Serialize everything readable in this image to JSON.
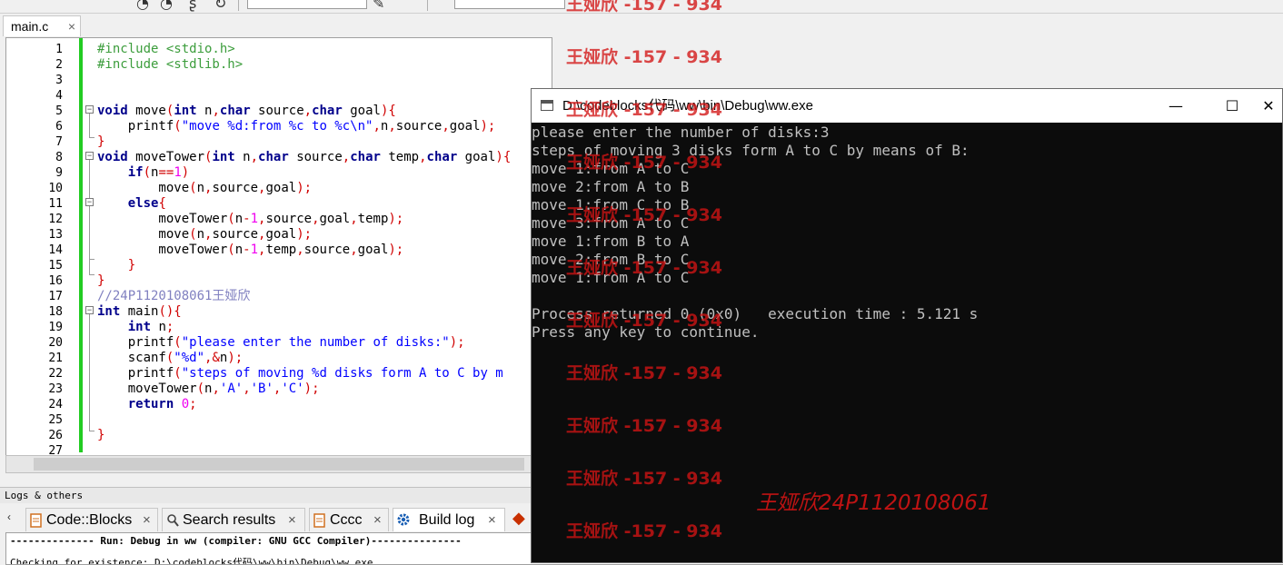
{
  "editor": {
    "tab_label": "main.c",
    "tab_close": "×",
    "line_numbers": [
      "1",
      "2",
      "3",
      "4",
      "5",
      "6",
      "7",
      "8",
      "9",
      "10",
      "11",
      "12",
      "13",
      "14",
      "15",
      "16",
      "17",
      "18",
      "19",
      "20",
      "21",
      "22",
      "23",
      "24",
      "25",
      "26",
      "27"
    ],
    "lines": [
      [
        {
          "t": "pp",
          "v": "#include <stdio.h>"
        }
      ],
      [
        {
          "t": "pp",
          "v": "#include <stdlib.h>"
        }
      ],
      [],
      [],
      [
        {
          "t": "kw",
          "v": "void"
        },
        {
          "t": "pl",
          "v": " move"
        },
        {
          "t": "op",
          "v": "("
        },
        {
          "t": "kw",
          "v": "int"
        },
        {
          "t": "pl",
          "v": " n"
        },
        {
          "t": "op",
          "v": ","
        },
        {
          "t": "kw",
          "v": "char"
        },
        {
          "t": "pl",
          "v": " source"
        },
        {
          "t": "op",
          "v": ","
        },
        {
          "t": "kw",
          "v": "char"
        },
        {
          "t": "pl",
          "v": " goal"
        },
        {
          "t": "op",
          "v": "){"
        }
      ],
      [
        {
          "t": "pl",
          "v": "    printf"
        },
        {
          "t": "op",
          "v": "("
        },
        {
          "t": "str",
          "v": "\"move %d:from %c to %c\\n\""
        },
        {
          "t": "op",
          "v": ","
        },
        {
          "t": "pl",
          "v": "n"
        },
        {
          "t": "op",
          "v": ","
        },
        {
          "t": "pl",
          "v": "source"
        },
        {
          "t": "op",
          "v": ","
        },
        {
          "t": "pl",
          "v": "goal"
        },
        {
          "t": "op",
          "v": ");"
        }
      ],
      [
        {
          "t": "op",
          "v": "}"
        }
      ],
      [
        {
          "t": "kw",
          "v": "void"
        },
        {
          "t": "pl",
          "v": " moveTower"
        },
        {
          "t": "op",
          "v": "("
        },
        {
          "t": "kw",
          "v": "int"
        },
        {
          "t": "pl",
          "v": " n"
        },
        {
          "t": "op",
          "v": ","
        },
        {
          "t": "kw",
          "v": "char"
        },
        {
          "t": "pl",
          "v": " source"
        },
        {
          "t": "op",
          "v": ","
        },
        {
          "t": "kw",
          "v": "char"
        },
        {
          "t": "pl",
          "v": " temp"
        },
        {
          "t": "op",
          "v": ","
        },
        {
          "t": "kw",
          "v": "char"
        },
        {
          "t": "pl",
          "v": " goal"
        },
        {
          "t": "op",
          "v": "){"
        }
      ],
      [
        {
          "t": "pl",
          "v": "    "
        },
        {
          "t": "kw",
          "v": "if"
        },
        {
          "t": "op",
          "v": "("
        },
        {
          "t": "pl",
          "v": "n"
        },
        {
          "t": "op",
          "v": "=="
        },
        {
          "t": "num",
          "v": "1"
        },
        {
          "t": "op",
          "v": ")"
        }
      ],
      [
        {
          "t": "pl",
          "v": "        move"
        },
        {
          "t": "op",
          "v": "("
        },
        {
          "t": "pl",
          "v": "n"
        },
        {
          "t": "op",
          "v": ","
        },
        {
          "t": "pl",
          "v": "source"
        },
        {
          "t": "op",
          "v": ","
        },
        {
          "t": "pl",
          "v": "goal"
        },
        {
          "t": "op",
          "v": ");"
        }
      ],
      [
        {
          "t": "pl",
          "v": "    "
        },
        {
          "t": "kw",
          "v": "else"
        },
        {
          "t": "op",
          "v": "{"
        }
      ],
      [
        {
          "t": "pl",
          "v": "        moveTower"
        },
        {
          "t": "op",
          "v": "("
        },
        {
          "t": "pl",
          "v": "n"
        },
        {
          "t": "op",
          "v": "-"
        },
        {
          "t": "num",
          "v": "1"
        },
        {
          "t": "op",
          "v": ","
        },
        {
          "t": "pl",
          "v": "source"
        },
        {
          "t": "op",
          "v": ","
        },
        {
          "t": "pl",
          "v": "goal"
        },
        {
          "t": "op",
          "v": ","
        },
        {
          "t": "pl",
          "v": "temp"
        },
        {
          "t": "op",
          "v": ");"
        }
      ],
      [
        {
          "t": "pl",
          "v": "        move"
        },
        {
          "t": "op",
          "v": "("
        },
        {
          "t": "pl",
          "v": "n"
        },
        {
          "t": "op",
          "v": ","
        },
        {
          "t": "pl",
          "v": "source"
        },
        {
          "t": "op",
          "v": ","
        },
        {
          "t": "pl",
          "v": "goal"
        },
        {
          "t": "op",
          "v": ");"
        }
      ],
      [
        {
          "t": "pl",
          "v": "        moveTower"
        },
        {
          "t": "op",
          "v": "("
        },
        {
          "t": "pl",
          "v": "n"
        },
        {
          "t": "op",
          "v": "-"
        },
        {
          "t": "num",
          "v": "1"
        },
        {
          "t": "op",
          "v": ","
        },
        {
          "t": "pl",
          "v": "temp"
        },
        {
          "t": "op",
          "v": ","
        },
        {
          "t": "pl",
          "v": "source"
        },
        {
          "t": "op",
          "v": ","
        },
        {
          "t": "pl",
          "v": "goal"
        },
        {
          "t": "op",
          "v": ");"
        }
      ],
      [
        {
          "t": "pl",
          "v": "    "
        },
        {
          "t": "op",
          "v": "}"
        }
      ],
      [
        {
          "t": "op",
          "v": "}"
        }
      ],
      [
        {
          "t": "cm",
          "v": "//24P1120108061王娅欣"
        }
      ],
      [
        {
          "t": "kw",
          "v": "int"
        },
        {
          "t": "pl",
          "v": " main"
        },
        {
          "t": "op",
          "v": "(){"
        }
      ],
      [
        {
          "t": "pl",
          "v": "    "
        },
        {
          "t": "kw",
          "v": "int"
        },
        {
          "t": "pl",
          "v": " n"
        },
        {
          "t": "op",
          "v": ";"
        }
      ],
      [
        {
          "t": "pl",
          "v": "    printf"
        },
        {
          "t": "op",
          "v": "("
        },
        {
          "t": "str",
          "v": "\"please enter the number of disks:\""
        },
        {
          "t": "op",
          "v": ");"
        }
      ],
      [
        {
          "t": "pl",
          "v": "    scanf"
        },
        {
          "t": "op",
          "v": "("
        },
        {
          "t": "str",
          "v": "\"%d\""
        },
        {
          "t": "op",
          "v": ",&"
        },
        {
          "t": "pl",
          "v": "n"
        },
        {
          "t": "op",
          "v": ");"
        }
      ],
      [
        {
          "t": "pl",
          "v": "    printf"
        },
        {
          "t": "op",
          "v": "("
        },
        {
          "t": "str",
          "v": "\"steps of moving %d disks form A to C by m"
        }
      ],
      [
        {
          "t": "pl",
          "v": "    moveTower"
        },
        {
          "t": "op",
          "v": "("
        },
        {
          "t": "pl",
          "v": "n"
        },
        {
          "t": "op",
          "v": ","
        },
        {
          "t": "str",
          "v": "'A'"
        },
        {
          "t": "op",
          "v": ","
        },
        {
          "t": "str",
          "v": "'B'"
        },
        {
          "t": "op",
          "v": ","
        },
        {
          "t": "str",
          "v": "'C'"
        },
        {
          "t": "op",
          "v": ");"
        }
      ],
      [
        {
          "t": "pl",
          "v": "    "
        },
        {
          "t": "kw",
          "v": "return"
        },
        {
          "t": "pl",
          "v": " "
        },
        {
          "t": "num",
          "v": "0"
        },
        {
          "t": "op",
          "v": ";"
        }
      ],
      [],
      [
        {
          "t": "op",
          "v": "}"
        }
      ],
      []
    ]
  },
  "logs": {
    "header": "Logs & others",
    "tabs": [
      {
        "label": "Code::Blocks",
        "close": "×"
      },
      {
        "label": "Search results",
        "close": "×"
      },
      {
        "label": "Cccc",
        "close": "×"
      },
      {
        "label": "Build log",
        "close": "×"
      }
    ],
    "lines": [
      "-------------- Run: Debug in ww (compiler: GNU GCC Compiler)---------------",
      "Checking for existence: D:\\codeblocks代码\\ww\\bin\\Debug\\ww.exe"
    ]
  },
  "console": {
    "title": "D:\\codeblocks代码\\ww\\bin\\Debug\\ww.exe",
    "minimize": "—",
    "maximize": "☐",
    "close": "✕",
    "output": [
      "please enter the number of disks:3",
      "steps of moving 3 disks form A to C by means of B:",
      "move 1:from A to C",
      "move 2:from A to B",
      "move 1:from C to B",
      "move 3:from A to C",
      "move 1:from B to A",
      "move 2:from B to C",
      "move 1:from A to C",
      "",
      "Process returned 0 (0x0)   execution time : 5.121 s",
      "Press any key to continue."
    ]
  },
  "watermark": {
    "text": "王娅欣 -157 - 934",
    "signature": "王娅欣24P1120108061"
  },
  "colors": {
    "changebar": "#22cc22",
    "console_bg": "#0c0c0c",
    "console_fg": "#c0c0c0",
    "watermark": "#d21414"
  }
}
